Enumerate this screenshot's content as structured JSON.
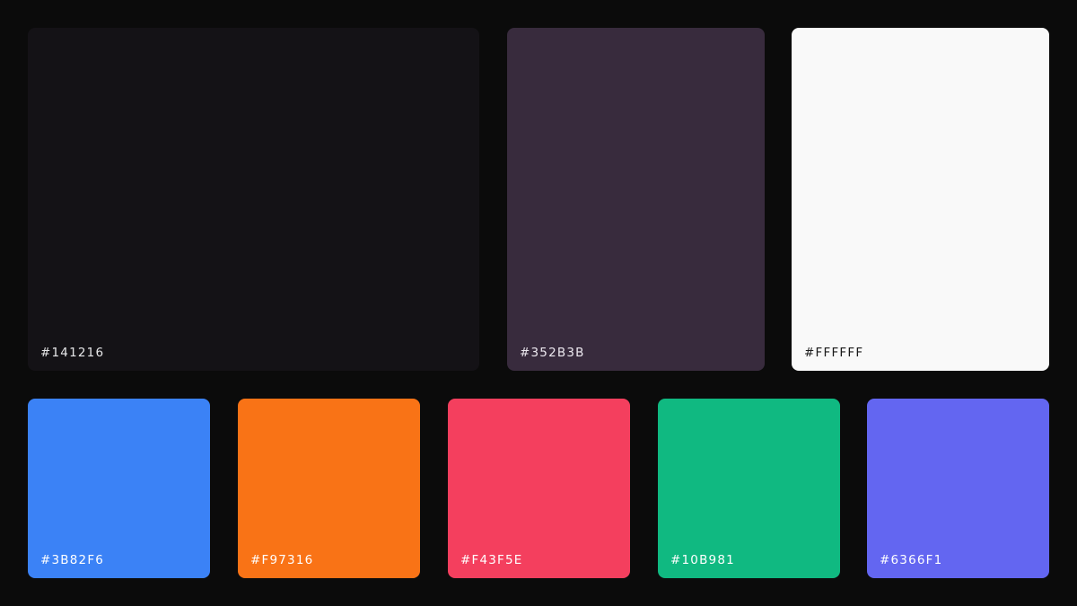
{
  "swatches": [
    {
      "label": "#141216",
      "fill": "#141216",
      "text_color": "#e8e8ea"
    },
    {
      "label": "#352B3B",
      "fill": "#382b3d",
      "text_color": "#ece8ef"
    },
    {
      "label": "#FFFFFF",
      "fill": "#f9f9f9",
      "text_color": "#1a1a1a"
    },
    {
      "label": "#3B82F6",
      "fill": "#3b82f6",
      "text_color": "#ffffff"
    },
    {
      "label": "#F97316",
      "fill": "#f97316",
      "text_color": "#ffffff"
    },
    {
      "label": "#F43F5E",
      "fill": "#f43f5e",
      "text_color": "#ffffff"
    },
    {
      "label": "#10B981",
      "fill": "#10b981",
      "text_color": "#ffffff"
    },
    {
      "label": "#6366F1",
      "fill": "#6366f1",
      "text_color": "#ffffff"
    }
  ]
}
